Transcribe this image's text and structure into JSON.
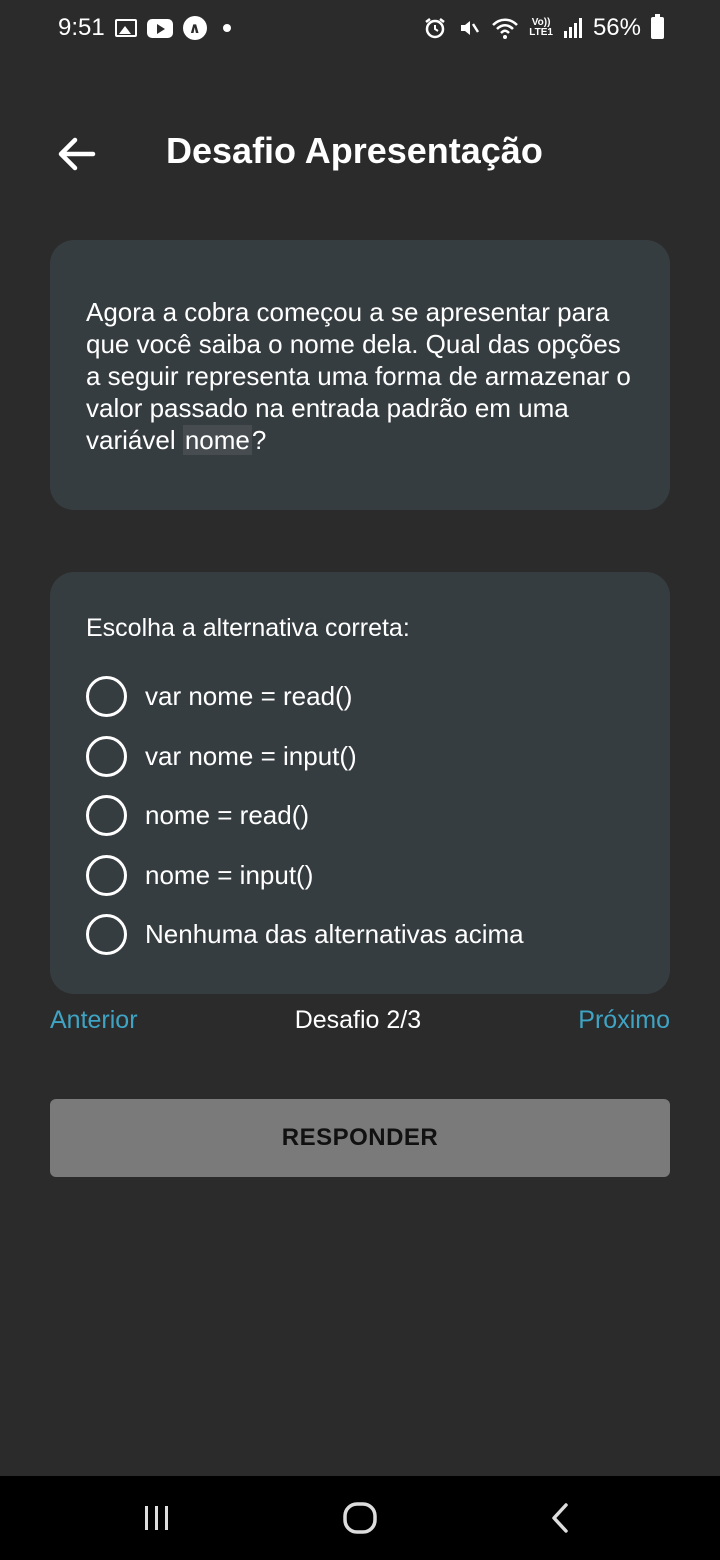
{
  "status_bar": {
    "time": "9:51",
    "battery": "56%",
    "lte_top": "Vo))",
    "lte_bottom": "LTE1"
  },
  "header": {
    "title": "Desafio Apresentação"
  },
  "question": {
    "text_before": "Agora a cobra começou a se apresentar para que você saiba o nome dela. Qual das opções a seguir representa uma forma de armazenar o valor passado na entrada padrão em uma variável ",
    "code_var": "nome",
    "text_after": "?"
  },
  "options": {
    "prompt": "Escolha a alternativa correta:",
    "items": [
      {
        "label": "var nome = read()"
      },
      {
        "label": "var nome = input()"
      },
      {
        "label": "nome = read()"
      },
      {
        "label": "nome = input()"
      },
      {
        "label": "Nenhuma das alternativas acima"
      }
    ]
  },
  "navigation": {
    "previous": "Anterior",
    "progress": "Desafio 2/3",
    "next": "Próximo"
  },
  "submit": {
    "label": "RESPONDER"
  },
  "colors": {
    "background": "#2b2b2b",
    "card": "#363d41",
    "link": "#3fa4c4",
    "button": "#7a7a7a"
  }
}
